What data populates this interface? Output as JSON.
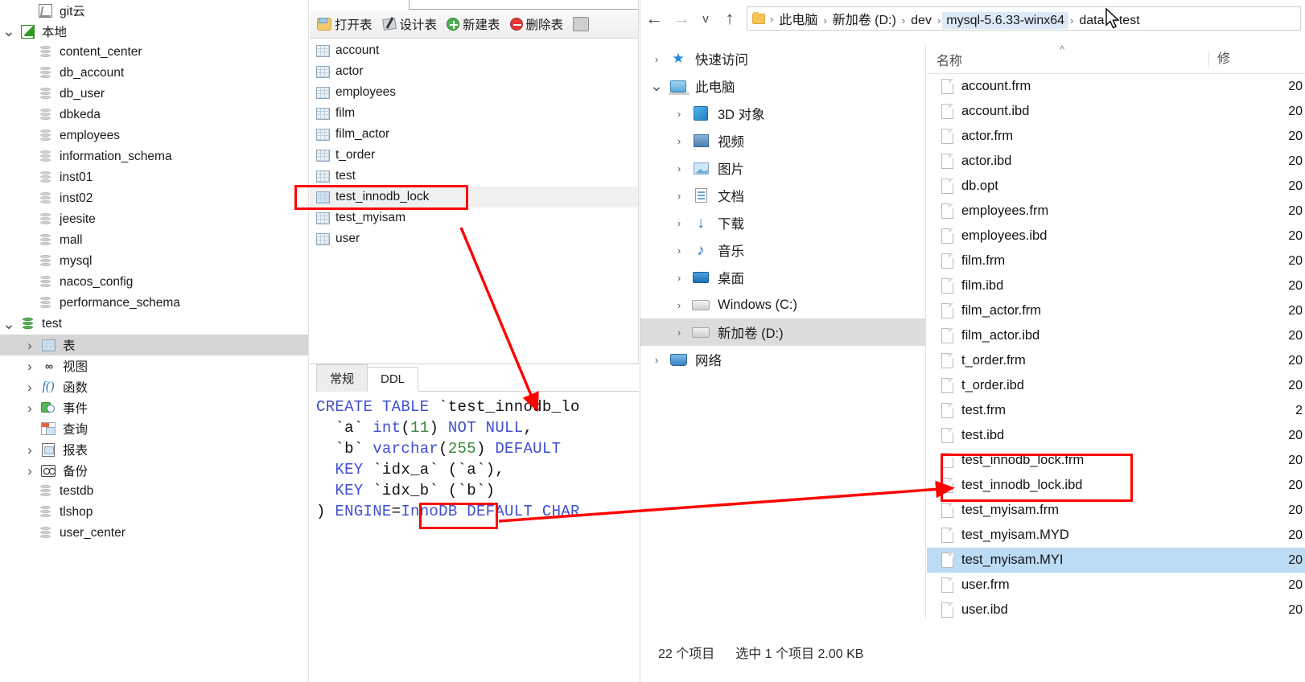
{
  "db_tool": {
    "connections": [
      {
        "label": "git云",
        "icon": "git-repo-icon",
        "indent": 0,
        "twisty": "",
        "selected": false,
        "type": "conn"
      },
      {
        "label": "本地",
        "icon": "git-repo-icon-green",
        "indent": 0,
        "twisty": "v",
        "selected": false,
        "type": "conn"
      }
    ],
    "databases": [
      {
        "label": "content_center",
        "icon": "database-icon"
      },
      {
        "label": "db_account",
        "icon": "database-icon"
      },
      {
        "label": "db_user",
        "icon": "database-icon"
      },
      {
        "label": "dbkeda",
        "icon": "database-icon"
      },
      {
        "label": "employees",
        "icon": "database-icon"
      },
      {
        "label": "information_schema",
        "icon": "database-icon"
      },
      {
        "label": "inst01",
        "icon": "database-icon"
      },
      {
        "label": "inst02",
        "icon": "database-icon"
      },
      {
        "label": "jeesite",
        "icon": "database-icon"
      },
      {
        "label": "mall",
        "icon": "database-icon"
      },
      {
        "label": "mysql",
        "icon": "database-icon"
      },
      {
        "label": "nacos_config",
        "icon": "database-icon"
      },
      {
        "label": "performance_schema",
        "icon": "database-icon"
      }
    ],
    "active_db": {
      "label": "test",
      "icon": "database-icon-green",
      "twisty": "v"
    },
    "db_children": [
      {
        "label": "表",
        "icon": "table-grid-icon",
        "twisty": ">",
        "selected": true
      },
      {
        "label": "视图",
        "icon": "view-icon",
        "twisty": ">",
        "selected": false
      },
      {
        "label": "函数",
        "icon": "function-icon",
        "twisty": ">",
        "selected": false
      },
      {
        "label": "事件",
        "icon": "event-icon",
        "twisty": ">",
        "selected": false
      },
      {
        "label": "查询",
        "icon": "query-icon",
        "twisty": "",
        "selected": false
      },
      {
        "label": "报表",
        "icon": "report-icon",
        "twisty": ">",
        "selected": false
      },
      {
        "label": "备份",
        "icon": "backup-icon",
        "twisty": ">",
        "selected": false
      }
    ],
    "databases_after": [
      {
        "label": "testdb",
        "icon": "database-icon"
      },
      {
        "label": "tlshop",
        "icon": "database-icon"
      },
      {
        "label": "user_center",
        "icon": "database-icon"
      }
    ],
    "toolbar": [
      {
        "label": "打开表",
        "icon": "open-table-icon"
      },
      {
        "label": "设计表",
        "icon": "design-table-icon"
      },
      {
        "label": "新建表",
        "icon": "new-table-icon"
      },
      {
        "label": "删除表",
        "icon": "delete-table-icon"
      }
    ],
    "tables": [
      {
        "label": "account",
        "highlighted": false
      },
      {
        "label": "actor",
        "highlighted": false
      },
      {
        "label": "employees",
        "highlighted": false
      },
      {
        "label": "film",
        "highlighted": false
      },
      {
        "label": "film_actor",
        "highlighted": false
      },
      {
        "label": "t_order",
        "highlighted": false
      },
      {
        "label": "test",
        "highlighted": false
      },
      {
        "label": "test_innodb_lock",
        "highlighted": true
      },
      {
        "label": "test_myisam",
        "highlighted": false
      },
      {
        "label": "user",
        "highlighted": false
      }
    ],
    "ddl": {
      "tabs": [
        {
          "label": "常规",
          "active": false
        },
        {
          "label": "DDL",
          "active": true
        }
      ],
      "lines": [
        "CREATE TABLE `test_innodb_lo",
        "  `a` int(11) NOT NULL,",
        "  `b` varchar(255) DEFAULT ",
        "  KEY `idx_a` (`a`),",
        "  KEY `idx_b` (`b`)",
        ") ENGINE=InnoDB DEFAULT CHAR"
      ],
      "engine_highlight": "InnoDB"
    }
  },
  "explorer": {
    "nav": {
      "back": "←",
      "forward": "→",
      "recent": "v",
      "up": "↑"
    },
    "breadcrumb": [
      "此电脑",
      "新加卷 (D:)",
      "dev",
      "mysql-5.6.33-winx64",
      "data",
      "test"
    ],
    "breadcrumb_highlighted": "mysql-5.6.33-winx64",
    "tree": [
      {
        "label": "快速访问",
        "icon": "star-icon",
        "twisty": ">",
        "indent": 0,
        "selected": false
      },
      {
        "label": "此电脑",
        "icon": "this-pc-icon",
        "twisty": "v",
        "indent": 0,
        "selected": false
      },
      {
        "label": "3D 对象",
        "icon": "3d-objects-icon",
        "twisty": ">",
        "indent": 1,
        "selected": false
      },
      {
        "label": "视频",
        "icon": "videos-icon",
        "twisty": ">",
        "indent": 1,
        "selected": false
      },
      {
        "label": "图片",
        "icon": "pictures-icon",
        "twisty": ">",
        "indent": 1,
        "selected": false
      },
      {
        "label": "文档",
        "icon": "documents-icon",
        "twisty": ">",
        "indent": 1,
        "selected": false
      },
      {
        "label": "下载",
        "icon": "downloads-icon",
        "twisty": ">",
        "indent": 1,
        "selected": false
      },
      {
        "label": "音乐",
        "icon": "music-icon",
        "twisty": ">",
        "indent": 1,
        "selected": false
      },
      {
        "label": "桌面",
        "icon": "desktop-icon",
        "twisty": ">",
        "indent": 1,
        "selected": false
      },
      {
        "label": "Windows (C:)",
        "icon": "drive-icon",
        "twisty": ">",
        "indent": 1,
        "selected": false
      },
      {
        "label": "新加卷 (D:)",
        "icon": "drive-icon",
        "twisty": ">",
        "indent": 1,
        "selected": true
      },
      {
        "label": "网络",
        "icon": "network-icon",
        "twisty": ">",
        "indent": 0,
        "selected": false
      }
    ],
    "columns": {
      "name": "名称",
      "modified": "修"
    },
    "files": [
      {
        "name": "account.frm",
        "date": "20",
        "selected": false,
        "boxed": false
      },
      {
        "name": "account.ibd",
        "date": "20",
        "selected": false,
        "boxed": false
      },
      {
        "name": "actor.frm",
        "date": "20",
        "selected": false,
        "boxed": false
      },
      {
        "name": "actor.ibd",
        "date": "20",
        "selected": false,
        "boxed": false
      },
      {
        "name": "db.opt",
        "date": "20",
        "selected": false,
        "boxed": false
      },
      {
        "name": "employees.frm",
        "date": "20",
        "selected": false,
        "boxed": false
      },
      {
        "name": "employees.ibd",
        "date": "20",
        "selected": false,
        "boxed": false
      },
      {
        "name": "film.frm",
        "date": "20",
        "selected": false,
        "boxed": false
      },
      {
        "name": "film.ibd",
        "date": "20",
        "selected": false,
        "boxed": false
      },
      {
        "name": "film_actor.frm",
        "date": "20",
        "selected": false,
        "boxed": false
      },
      {
        "name": "film_actor.ibd",
        "date": "20",
        "selected": false,
        "boxed": false
      },
      {
        "name": "t_order.frm",
        "date": "20",
        "selected": false,
        "boxed": false
      },
      {
        "name": "t_order.ibd",
        "date": "20",
        "selected": false,
        "boxed": false
      },
      {
        "name": "test.frm",
        "date": "2",
        "selected": false,
        "boxed": false
      },
      {
        "name": "test.ibd",
        "date": "20",
        "selected": false,
        "boxed": false
      },
      {
        "name": "test_innodb_lock.frm",
        "date": "20",
        "selected": false,
        "boxed": true
      },
      {
        "name": "test_innodb_lock.ibd",
        "date": "20",
        "selected": false,
        "boxed": true
      },
      {
        "name": "test_myisam.frm",
        "date": "20",
        "selected": false,
        "boxed": false
      },
      {
        "name": "test_myisam.MYD",
        "date": "20",
        "selected": false,
        "boxed": false
      },
      {
        "name": "test_myisam.MYI",
        "date": "20",
        "selected": true,
        "boxed": false
      },
      {
        "name": "user.frm",
        "date": "20",
        "selected": false,
        "boxed": false
      },
      {
        "name": "user.ibd",
        "date": "20",
        "selected": false,
        "boxed": false
      }
    ],
    "status": {
      "count": "22 个项目",
      "selection": "选中 1 个项目  2.00 KB"
    }
  },
  "annotations": {
    "accent_red": "#ff0000",
    "boxes": [
      "test_innodb_lock table row",
      "InnoDB engine keyword",
      "test_innodb_lock.frm / .ibd files"
    ],
    "arrows": [
      "table row to DDL code",
      "DDL engine to explorer files"
    ]
  }
}
